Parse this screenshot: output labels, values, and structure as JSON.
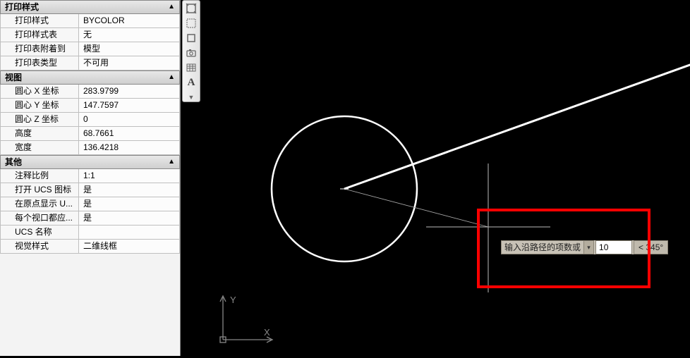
{
  "sections": {
    "print": {
      "title": "打印样式"
    },
    "view": {
      "title": "视图"
    },
    "other": {
      "title": "其他"
    }
  },
  "props": {
    "print_style": {
      "label": "打印样式",
      "value": "BYCOLOR"
    },
    "print_style_table": {
      "label": "打印样式表",
      "value": "无"
    },
    "print_attach": {
      "label": "打印表附着到",
      "value": "模型"
    },
    "print_type": {
      "label": "打印表类型",
      "value": "不可用"
    },
    "center_x": {
      "label": "圆心 X 坐标",
      "value": "283.9799"
    },
    "center_y": {
      "label": "圆心 Y 坐标",
      "value": "147.7597"
    },
    "center_z": {
      "label": "圆心 Z 坐标",
      "value": "0"
    },
    "height": {
      "label": "高度",
      "value": "68.7661"
    },
    "width": {
      "label": "宽度",
      "value": "136.4218"
    },
    "anno_scale": {
      "label": "注释比例",
      "value": "1:1"
    },
    "ucs_icon": {
      "label": "打开 UCS 图标",
      "value": "是"
    },
    "ucs_origin": {
      "label": "在原点显示 U...",
      "value": "是"
    },
    "ucs_vp": {
      "label": "每个视口都应...",
      "value": "是"
    },
    "ucs_name": {
      "label": "UCS 名称",
      "value": ""
    },
    "visual_style": {
      "label": "视觉样式",
      "value": "二维线框"
    }
  },
  "input": {
    "prompt": "输入沿路径的项数或",
    "value": "10",
    "angle": "<  345°"
  },
  "axes": {
    "x": "X",
    "y": "Y"
  }
}
